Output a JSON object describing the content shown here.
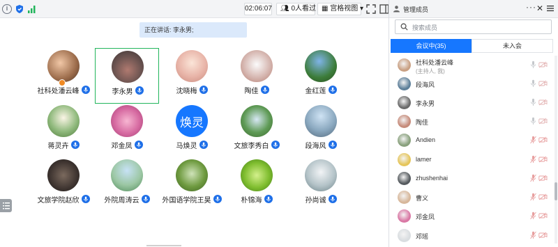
{
  "toolbar": {
    "time": "02:06:07",
    "watch_count": "0人看过",
    "view_mode": "宫格视图",
    "view_arrow": "▾"
  },
  "speaking": {
    "text": "正在讲话: 李永男;"
  },
  "participants": [
    {
      "name": "社科处潘云峰"
    },
    {
      "name": "李永男"
    },
    {
      "name": "沈晓梅"
    },
    {
      "name": "陶佳"
    },
    {
      "name": "金红莲"
    },
    {
      "name": "蒋灵卉"
    },
    {
      "name": "邓金凤"
    },
    {
      "name": "马焕灵",
      "avatar_text": "焕灵"
    },
    {
      "name": "文旅李秀白"
    },
    {
      "name": "段海风"
    },
    {
      "name": "文旅学院赵欣"
    },
    {
      "name": "外院周涛云"
    },
    {
      "name": "外国语学院王昊"
    },
    {
      "name": "朴锦海"
    },
    {
      "name": "孙尚诚"
    }
  ],
  "panel": {
    "title": "管理成员",
    "more": "···",
    "close": "✕",
    "search_placeholder": "搜索成员",
    "tab_in": "会议中(35)",
    "tab_out": "未入会",
    "members": [
      {
        "name": "社科处潘云峰",
        "sub": "(主持人, 我)",
        "muted": false
      },
      {
        "name": "段海风",
        "muted": false
      },
      {
        "name": "李永男",
        "muted": false
      },
      {
        "name": "陶佳",
        "muted": false
      },
      {
        "name": "Andien",
        "muted": true
      },
      {
        "name": "lamer",
        "muted": true
      },
      {
        "name": "zhushenhai",
        "muted": true
      },
      {
        "name": "曹义",
        "muted": true
      },
      {
        "name": "邓金凤",
        "muted": true
      },
      {
        "name": "邓瑶",
        "muted": true
      }
    ]
  },
  "colors": {
    "accent": "#1677ff",
    "active_border": "#21b55b",
    "mic_blue": "#1e6fe8",
    "muted_red": "#e8a0a0",
    "banner": "#dbe9fb"
  }
}
